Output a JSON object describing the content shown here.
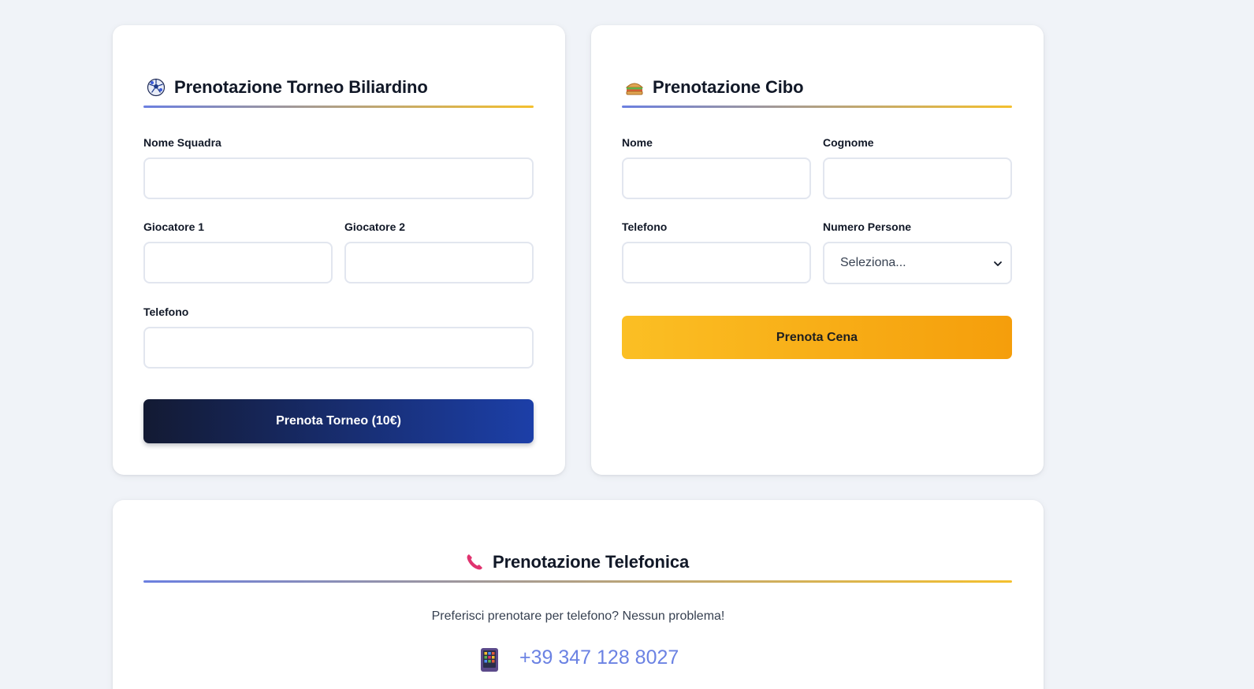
{
  "tournament": {
    "icon": "soccer-ball-icon",
    "title": "Prenotazione Torneo Biliardino",
    "team_label": "Nome Squadra",
    "player1_label": "Giocatore 1",
    "player2_label": "Giocatore 2",
    "phone_label": "Telefono",
    "team_value": "",
    "player1_value": "",
    "player2_value": "",
    "phone_value": "",
    "button_label": "Prenota Torneo (10€)"
  },
  "food": {
    "icon": "sandwich-icon",
    "title": "Prenotazione Cibo",
    "name_label": "Nome",
    "surname_label": "Cognome",
    "phone_label": "Telefono",
    "people_label": "Numero Persone",
    "name_value": "",
    "surname_value": "",
    "phone_value": "",
    "people_selected": "Seleziona...",
    "button_label": "Prenota Cena"
  },
  "phone_booking": {
    "icon": "telephone-receiver-icon",
    "title": "Prenotazione Telefonica",
    "subtitle": "Preferisci prenotare per telefono? Nessun problema!",
    "number_icon": "mobile-phone-icon",
    "number": "+39 347 128 8027"
  },
  "colors": {
    "background": "#f0f3f8",
    "accent_blue": "#6b82e3",
    "accent_yellow": "#f4c02e",
    "button_dark_start": "#131a33",
    "button_dark_end": "#1c3fa8",
    "button_amber_start": "#fbbf24",
    "button_amber_end": "#f59e0b"
  }
}
